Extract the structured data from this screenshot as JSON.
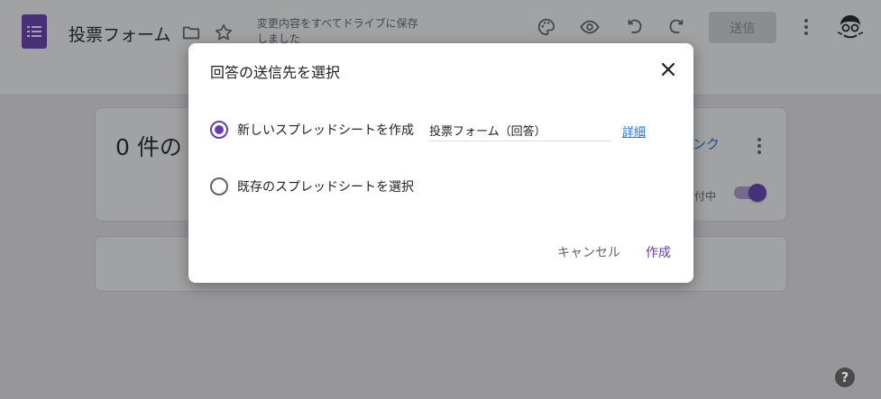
{
  "header": {
    "title": "投票フォーム",
    "save_status": "変更内容をすべてドライブに保存しました",
    "send_label": "送信",
    "icons": [
      "forms-logo-icon",
      "folder-icon",
      "star-icon",
      "palette-icon",
      "eye-icon",
      "undo-icon",
      "redo-icon",
      "more-vert-icon",
      "avatar"
    ]
  },
  "summary_card": {
    "response_count": "0 件の",
    "link_text": "ンク",
    "accepting_label": "付中"
  },
  "dialog": {
    "title": "回答の送信先を選択",
    "options": [
      {
        "label": "新しいスプレッドシートを作成",
        "selected": true
      },
      {
        "label": "既存のスプレッドシートを選択",
        "selected": false
      }
    ],
    "sheet_name_value": "投票フォーム（回答）",
    "details_link": "詳細",
    "cancel_label": "キャンセル",
    "create_label": "作成"
  },
  "help_glyph": "?",
  "colors": {
    "accent": "#673ab7",
    "link": "#1a73e8",
    "disabled_button_bg": "#dadce0"
  }
}
